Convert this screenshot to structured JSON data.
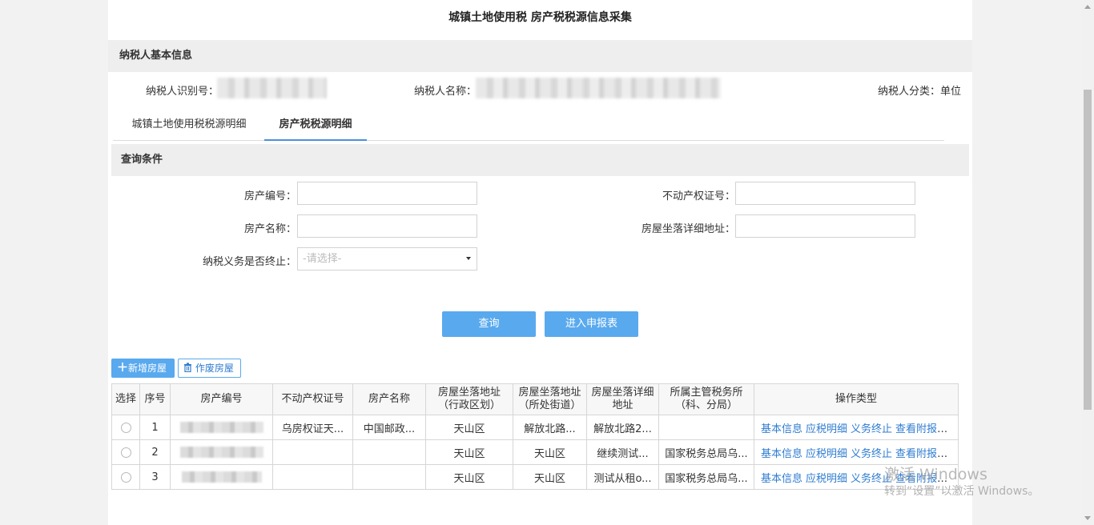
{
  "title": "城镇土地使用税  房产税税源信息采集",
  "basic_info": {
    "section_title": "纳税人基本信息",
    "taxpayer_id_label": "纳税人识别号：",
    "taxpayer_name_label": "纳税人名称：",
    "taxpayer_type_label": "纳税人分类：单位"
  },
  "tabs": [
    {
      "label": "城镇土地使用税税源明细",
      "active": false
    },
    {
      "label": "房产税税源明细",
      "active": true
    }
  ],
  "query": {
    "section_title": "查询条件",
    "property_no_label": "房产编号：",
    "property_no_value": "",
    "cert_no_label": "不动产权证号：",
    "cert_no_value": "",
    "property_name_label": "房产名称：",
    "property_name_value": "",
    "address_label": "房屋坐落详细地址：",
    "address_value": "",
    "terminated_label": "纳税义务是否终止：",
    "terminated_placeholder": "-请选择-",
    "search_button": "查询",
    "report_button": "进入申报表"
  },
  "actions": {
    "add_button": "新增房屋",
    "void_button": "作废房屋"
  },
  "table": {
    "headers": [
      "选择",
      "序号",
      "房产编号",
      "不动产权证号",
      "房产名称",
      "房屋坐落地址（行政区划）",
      "房屋坐落地址（所处街道）",
      "房屋坐落详细地址",
      "所属主管税务所（科、分局）",
      "操作类型"
    ],
    "rows": [
      {
        "seq": "1",
        "property_no": "F650000000010...",
        "cert_no": "乌房权证天...",
        "name": "中国邮政...",
        "district": "天山区",
        "street": "解放北路...",
        "detail": "解放北路2...",
        "office": ""
      },
      {
        "seq": "2",
        "property_no": "F650000000000...",
        "cert_no": "",
        "name": "",
        "district": "天山区",
        "street": "天山区",
        "detail": "继续测试...",
        "office": "国家税务总局乌..."
      },
      {
        "seq": "3",
        "property_no": "...",
        "cert_no": "",
        "name": "",
        "district": "天山区",
        "street": "天山区",
        "detail": "测试从租o...",
        "office": "国家税务总局乌..."
      }
    ],
    "ops": [
      "基本信息",
      "应税明细",
      "义务终止",
      "查看附报资..."
    ]
  },
  "watermark": {
    "line1": "激活 Windows",
    "line2": "转到“设置”以激活 Windows。"
  },
  "colors": {
    "accent": "#59a9ee",
    "link": "#2f7cd0",
    "section_bg": "#eeeeee"
  }
}
